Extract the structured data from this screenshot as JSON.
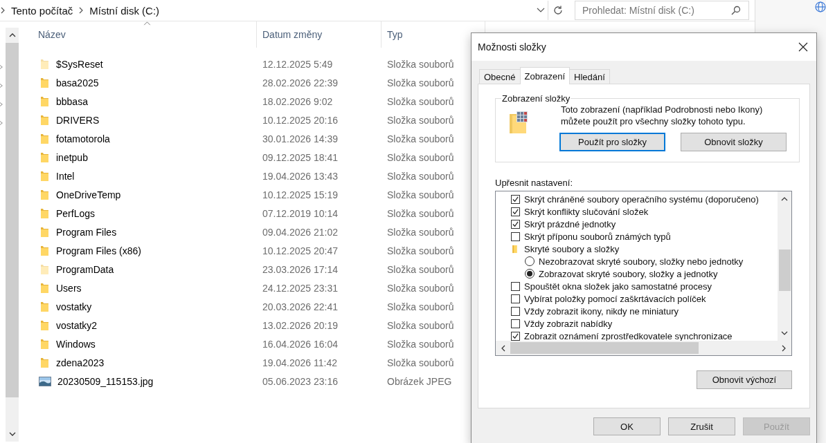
{
  "explorer": {
    "breadcrumb": [
      "Tento počítač",
      "Místní disk (C:)"
    ],
    "search": {
      "placeholder": "Prohledat: Místní disk (C:)"
    },
    "columns": [
      {
        "label": "Název",
        "sorted": true
      },
      {
        "label": "Datum změny",
        "sorted": false
      },
      {
        "label": "Typ",
        "sorted": false
      }
    ],
    "files": [
      {
        "name": "$SysReset",
        "date": "12.12.2025 5:49",
        "type": "Složka souborů",
        "kind": "folder",
        "hidden": true
      },
      {
        "name": "basa2025",
        "date": "28.02.2026 22:39",
        "type": "Složka souborů",
        "kind": "folder",
        "hidden": false
      },
      {
        "name": "bbbasa",
        "date": "18.02.2026 9:02",
        "type": "Složka souborů",
        "kind": "folder",
        "hidden": false
      },
      {
        "name": "DRIVERS",
        "date": "10.12.2025 20:16",
        "type": "Složka souborů",
        "kind": "folder",
        "hidden": false
      },
      {
        "name": "fotamotorola",
        "date": "30.01.2026 14:39",
        "type": "Složka souborů",
        "kind": "folder",
        "hidden": false
      },
      {
        "name": "inetpub",
        "date": "09.12.2025 18:41",
        "type": "Složka souborů",
        "kind": "folder",
        "hidden": false
      },
      {
        "name": "Intel",
        "date": "19.04.2026 13:43",
        "type": "Složka souborů",
        "kind": "folder",
        "hidden": false
      },
      {
        "name": "OneDriveTemp",
        "date": "10.12.2025 15:19",
        "type": "Složka souborů",
        "kind": "folder",
        "hidden": false
      },
      {
        "name": "PerfLogs",
        "date": "07.12.2019 10:14",
        "type": "Složka souborů",
        "kind": "folder",
        "hidden": false
      },
      {
        "name": "Program Files",
        "date": "09.04.2026 21:02",
        "type": "Složka souborů",
        "kind": "folder",
        "hidden": false
      },
      {
        "name": "Program Files (x86)",
        "date": "10.12.2025 20:47",
        "type": "Složka souborů",
        "kind": "folder",
        "hidden": false
      },
      {
        "name": "ProgramData",
        "date": "23.03.2026 17:14",
        "type": "Složka souborů",
        "kind": "folder",
        "hidden": true
      },
      {
        "name": "Users",
        "date": "24.12.2025 23:31",
        "type": "Složka souborů",
        "kind": "folder",
        "hidden": false
      },
      {
        "name": "vostatky",
        "date": "20.03.2026 22:41",
        "type": "Složka souborů",
        "kind": "folder",
        "hidden": false
      },
      {
        "name": "vostatky2",
        "date": "13.02.2026 20:19",
        "type": "Složka souborů",
        "kind": "folder",
        "hidden": false
      },
      {
        "name": "Windows",
        "date": "16.04.2026 16:04",
        "type": "Složka souborů",
        "kind": "folder",
        "hidden": false
      },
      {
        "name": "zdena2023",
        "date": "19.04.2026 11:42",
        "type": "Složka souborů",
        "kind": "folder",
        "hidden": false
      },
      {
        "name": "20230509_115153.jpg",
        "date": "05.06.2023 23:16",
        "type": "Obrázek JPEG",
        "kind": "image",
        "hidden": false
      }
    ]
  },
  "dialog": {
    "title": "Možnosti složky",
    "tabs": [
      {
        "label": "Obecné",
        "selected": false
      },
      {
        "label": "Zobrazení",
        "selected": true
      },
      {
        "label": "Hledání",
        "selected": false
      }
    ],
    "folder_views": {
      "title": "Zobrazení složky",
      "description": "Toto zobrazení (například Podrobnosti nebo Ikony) můžete použít pro všechny složky tohoto typu.",
      "buttons": [
        {
          "label": "Použít pro složky",
          "focused": true
        },
        {
          "label": "Obnovit složky",
          "focused": false
        }
      ]
    },
    "advanced_label": "Upřesnit nastavení:",
    "settings": [
      {
        "kind": "checkbox",
        "label": "Skrýt chráněné soubory operačního systému (doporučeno)",
        "checked": true
      },
      {
        "kind": "checkbox",
        "label": "Skrýt konflikty slučování složek",
        "checked": true
      },
      {
        "kind": "checkbox",
        "label": "Skrýt prázdné jednotky",
        "checked": true
      },
      {
        "kind": "checkbox",
        "label": "Skrýt příponu souborů známých typů",
        "checked": false
      },
      {
        "kind": "group",
        "label": "Skryté soubory a složky",
        "children": [
          {
            "kind": "radio",
            "label": "Nezobrazovat skryté soubory, složky nebo jednotky",
            "selected": false
          },
          {
            "kind": "radio",
            "label": "Zobrazovat skryté soubory, složky a jednotky",
            "selected": true
          }
        ]
      },
      {
        "kind": "checkbox",
        "label": "Spouštět okna složek jako samostatné procesy",
        "checked": false
      },
      {
        "kind": "checkbox",
        "label": "Vybírat položky pomocí zaškrtávacích políček",
        "checked": false
      },
      {
        "kind": "checkbox",
        "label": "Vždy zobrazit ikony, nikdy ne miniatury",
        "checked": false
      },
      {
        "kind": "checkbox",
        "label": "Vždy zobrazit nabídky",
        "checked": false
      },
      {
        "kind": "checkbox",
        "label": "Zobrazit oznámení zprostředkovatele synchronizace",
        "checked": true
      }
    ],
    "reset_button": "Obnovit výchozí",
    "footer_buttons": [
      {
        "label": "OK",
        "disabled": false
      },
      {
        "label": "Zrušit",
        "disabled": false
      },
      {
        "label": "Použít",
        "disabled": true
      }
    ]
  }
}
